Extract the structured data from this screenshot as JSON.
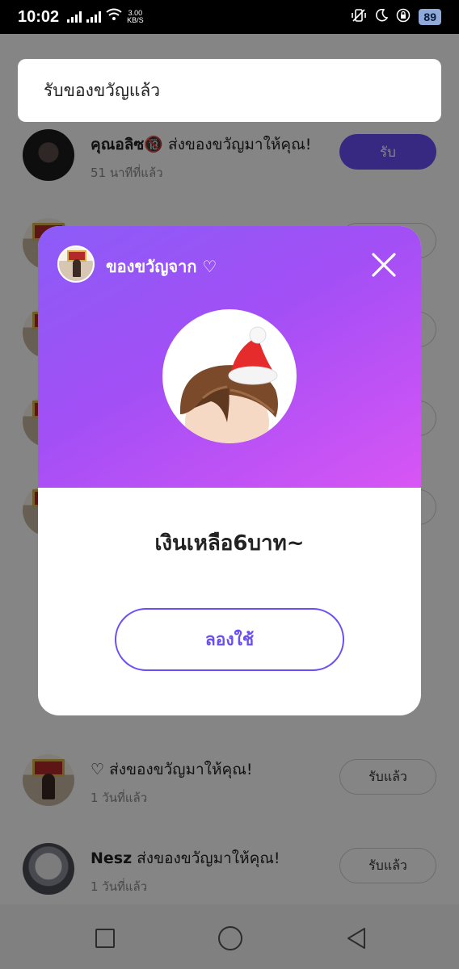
{
  "status_bar": {
    "time": "10:02",
    "speed_value": "3.00",
    "speed_unit": "KB/S",
    "battery": "89"
  },
  "list": {
    "rows": [
      {
        "name": "คุณอลิซ🔞",
        "action": "ส่งของขวัญมาให้คุณ!",
        "time": "51 นาทีที่แล้ว",
        "button": "รับ",
        "avatar": "dark-portrait"
      },
      {
        "name": "",
        "action": "",
        "time": "",
        "button": "",
        "avatar": "room-portrait"
      },
      {
        "name": "",
        "action": "",
        "time": "",
        "button": "",
        "avatar": "room-portrait"
      },
      {
        "name": "",
        "action": "",
        "time": "",
        "button": "",
        "avatar": "room-portrait"
      },
      {
        "name": "",
        "action": "",
        "time": "",
        "button": "",
        "avatar": "room-portrait"
      },
      {
        "name": "♡",
        "action": "ส่งของขวัญมาให้คุณ!",
        "time": "1 วันที่แล้ว",
        "button": "รับแล้ว",
        "avatar": "room-portrait"
      },
      {
        "name": "Nesz",
        "action": "ส่งของขวัญมาให้คุณ!",
        "time": "1 วันที่แล้ว",
        "button": "รับแล้ว",
        "avatar": "white-hair-portrait"
      }
    ]
  },
  "toast": {
    "message": "รับของขวัญแล้ว"
  },
  "modal": {
    "sender_label": "ของขวัญจาก ♡",
    "gift_item": "santa-hat-hair-icon",
    "message": "เงินเหลือ6บาท~",
    "try_button": "ลองใช้"
  },
  "colors": {
    "accent": "#6a4ff7",
    "header_gradient_start": "#8c5cf7",
    "header_gradient_end": "#d855f4"
  },
  "nav": {
    "icons": [
      "recent-apps-icon",
      "home-icon",
      "back-icon"
    ]
  }
}
